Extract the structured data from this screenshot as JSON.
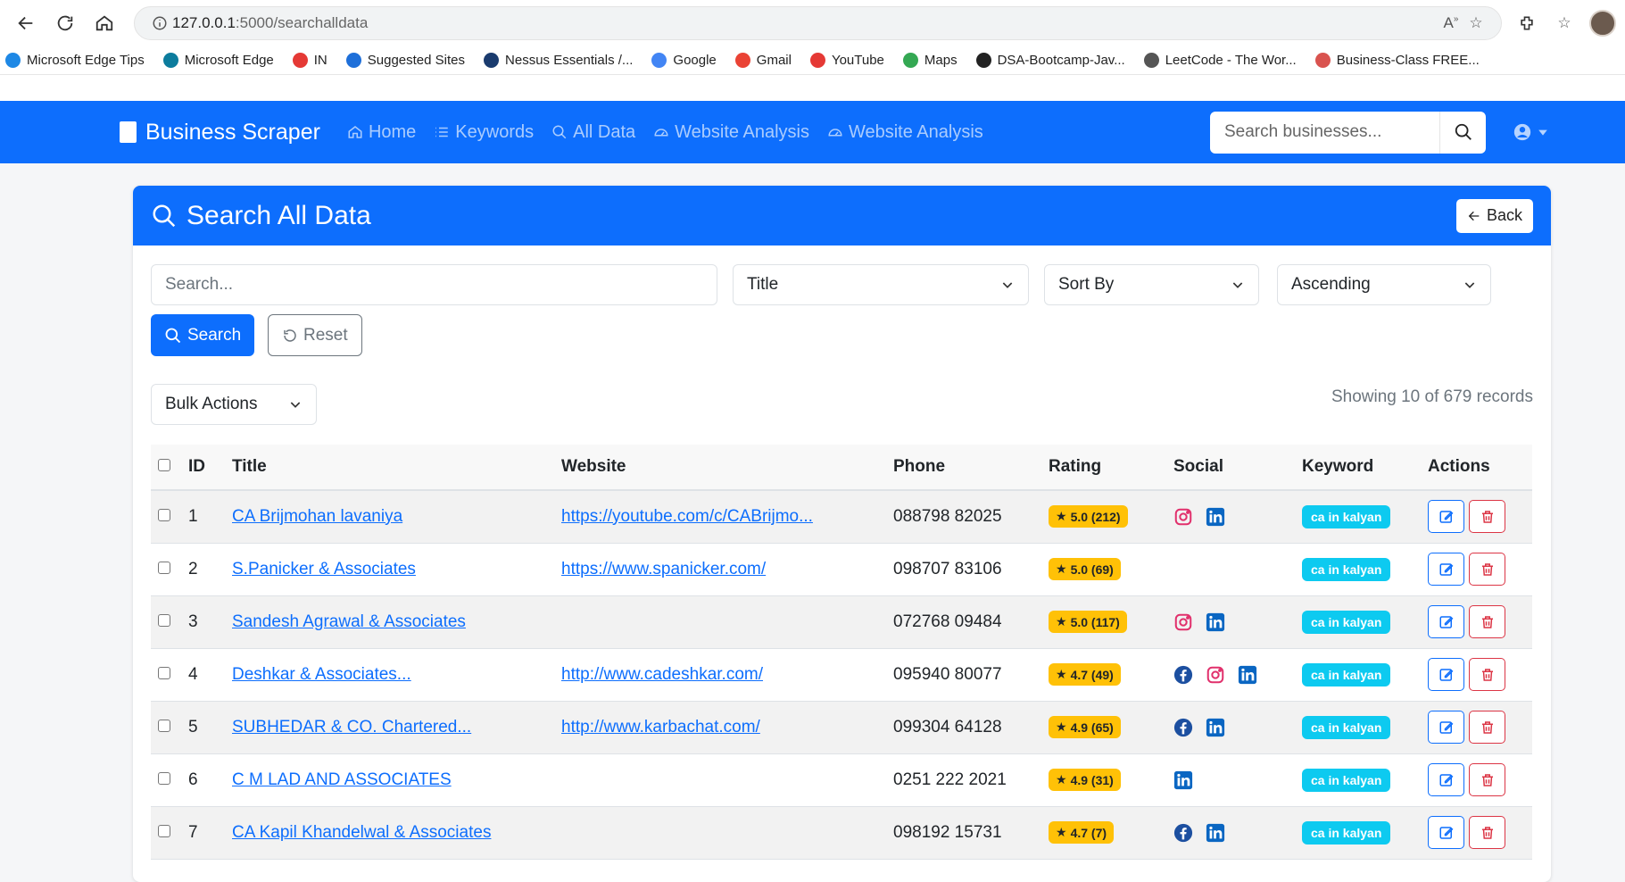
{
  "browser": {
    "url_host": "127.0.0.1",
    "url_path": ":5000/searchalldata",
    "bookmarks": [
      {
        "label": "Microsoft Edge Tips",
        "color": "#1e88e5"
      },
      {
        "label": "Microsoft Edge",
        "color": "#0c7c9d"
      },
      {
        "label": "IN",
        "color": "#e53935"
      },
      {
        "label": "Suggested Sites",
        "color": "#1e6fd9"
      },
      {
        "label": "Nessus Essentials /...",
        "color": "#1a3b6e"
      },
      {
        "label": "Google",
        "color": "#4285f4"
      },
      {
        "label": "Gmail",
        "color": "#ea4335"
      },
      {
        "label": "YouTube",
        "color": "#e53935"
      },
      {
        "label": "Maps",
        "color": "#34a853"
      },
      {
        "label": "DSA-Bootcamp-Jav...",
        "color": "#222222"
      },
      {
        "label": "LeetCode - The Wor...",
        "color": "#555555"
      },
      {
        "label": "Business-Class FREE...",
        "color": "#d9534f"
      }
    ]
  },
  "navbar": {
    "brand": "Business Scraper",
    "links": [
      {
        "label": "Home",
        "icon": "home-icon"
      },
      {
        "label": "Keywords",
        "icon": "list-icon"
      },
      {
        "label": "All Data",
        "icon": "search-icon"
      },
      {
        "label": "Website Analysis",
        "icon": "gauge-icon"
      },
      {
        "label": "Website Analysis",
        "icon": "gauge-icon"
      }
    ],
    "search_placeholder": "Search businesses..."
  },
  "card": {
    "title": "Search All Data",
    "back_label": "Back",
    "search_placeholder": "Search...",
    "field_select": "Title",
    "sort_select": "Sort By",
    "order_select": "Ascending",
    "search_button": "Search",
    "reset_button": "Reset",
    "bulk_actions": "Bulk Actions",
    "showing": "Showing 10 of 679 records"
  },
  "table": {
    "headers": [
      "ID",
      "Title",
      "Website",
      "Phone",
      "Rating",
      "Social",
      "Keyword",
      "Actions"
    ],
    "rows": [
      {
        "id": "1",
        "title": "CA Brijmohan lavaniya",
        "website": "https://youtube.com/c/CABrijmo...",
        "phone": "088798 82025",
        "rating": "5.0 (212)",
        "social": [
          "instagram",
          "linkedin"
        ],
        "keyword": "ca in kalyan"
      },
      {
        "id": "2",
        "title": "S.Panicker & Associates",
        "website": "https://www.spanicker.com/",
        "phone": "098707 83106",
        "rating": "5.0 (69)",
        "social": [],
        "keyword": "ca in kalyan"
      },
      {
        "id": "3",
        "title": "Sandesh Agrawal & Associates",
        "website": "",
        "phone": "072768 09484",
        "rating": "5.0 (117)",
        "social": [
          "instagram",
          "linkedin"
        ],
        "keyword": "ca in kalyan"
      },
      {
        "id": "4",
        "title": "Deshkar & Associates...",
        "website": "http://www.cadeshkar.com/",
        "phone": "095940 80077",
        "rating": "4.7 (49)",
        "social": [
          "facebook",
          "instagram",
          "linkedin"
        ],
        "keyword": "ca in kalyan"
      },
      {
        "id": "5",
        "title": "SUBHEDAR & CO. Chartered...",
        "website": "http://www.karbachat.com/",
        "phone": "099304 64128",
        "rating": "4.9 (65)",
        "social": [
          "facebook",
          "linkedin"
        ],
        "keyword": "ca in kalyan"
      },
      {
        "id": "6",
        "title": "C M LAD AND ASSOCIATES",
        "website": "",
        "phone": "0251 222 2021",
        "rating": "4.9 (31)",
        "social": [
          "linkedin"
        ],
        "keyword": "ca in kalyan"
      },
      {
        "id": "7",
        "title": "CA Kapil Khandelwal & Associates",
        "website": "",
        "phone": "098192 15731",
        "rating": "4.7 (7)",
        "social": [
          "facebook",
          "linkedin"
        ],
        "keyword": "ca in kalyan"
      }
    ]
  },
  "colors": {
    "primary": "#0d6efd",
    "rating_badge": "#ffc107",
    "keyword_badge": "#0dcaf0",
    "danger": "#dc3545"
  }
}
